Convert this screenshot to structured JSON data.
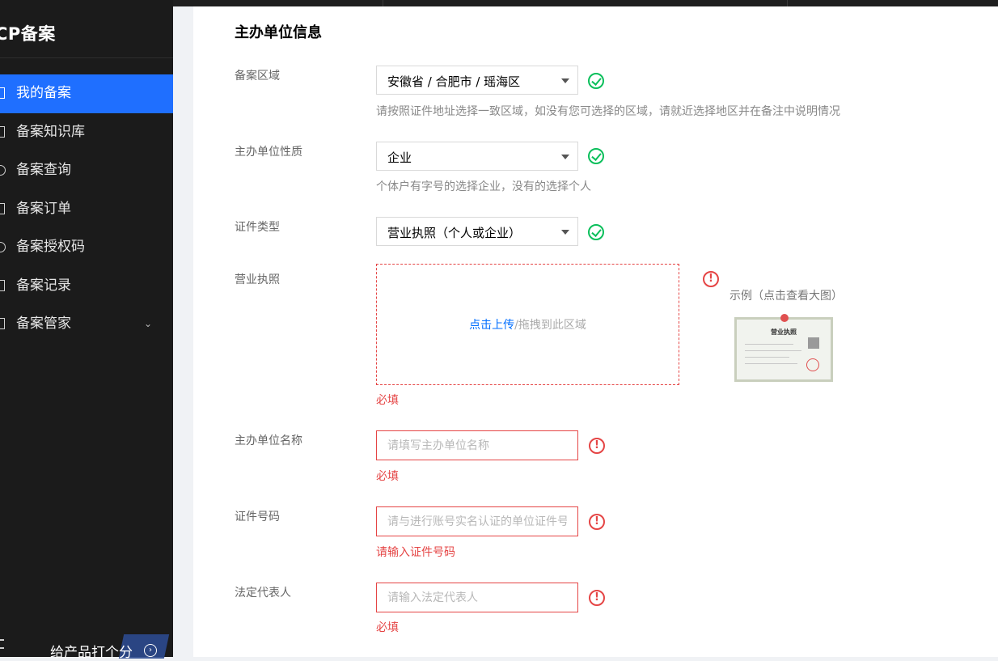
{
  "sidebar": {
    "brand": "CP备案",
    "items": [
      {
        "label": "我的备案",
        "active": true,
        "icon": "document-icon"
      },
      {
        "label": "备案知识库",
        "active": false,
        "icon": "book-icon"
      },
      {
        "label": "备案查询",
        "active": false,
        "icon": "search-icon"
      },
      {
        "label": "备案订单",
        "active": false,
        "icon": "order-icon"
      },
      {
        "label": "备案授权码",
        "active": false,
        "icon": "key-icon"
      },
      {
        "label": "备案记录",
        "active": false,
        "icon": "record-icon"
      },
      {
        "label": "备案管家",
        "active": false,
        "icon": "manager-icon",
        "expandable": true
      }
    ],
    "footer": {
      "rate_label": "给产品打个分"
    }
  },
  "section": {
    "title": "主办单位信息"
  },
  "form": {
    "region": {
      "label": "备案区域",
      "value": "安徽省 / 合肥市 / 瑶海区",
      "hint": "请按照证件地址选择一致区域，如没有您可选择的区域，请就近选择地区并在备注中说明情况"
    },
    "org_type": {
      "label": "主办单位性质",
      "value": "企业",
      "hint": "个体户有字号的选择企业，没有的选择个人"
    },
    "cert_type": {
      "label": "证件类型",
      "value": "营业执照（个人或企业）"
    },
    "license": {
      "label": "营业执照",
      "upload_link": "点击上传",
      "upload_text": "/拖拽到此区域",
      "error": "必填",
      "example_title": "示例（点击查看大图）",
      "example_doc_title": "营业执照"
    },
    "org_name": {
      "label": "主办单位名称",
      "placeholder": "请填写主办单位名称",
      "error": "必填"
    },
    "cert_number": {
      "label": "证件号码",
      "placeholder": "请与进行账号实名认证的单位证件号码一致",
      "error": "请输入证件号码"
    },
    "legal_rep": {
      "label": "法定代表人",
      "placeholder": "请输入法定代表人",
      "error": "必填"
    }
  },
  "colors": {
    "sidebar_bg": "#1b1b1b",
    "active_item": "#1f6fff",
    "success": "#0abf5b",
    "error": "#e54545",
    "link": "#006eff"
  }
}
